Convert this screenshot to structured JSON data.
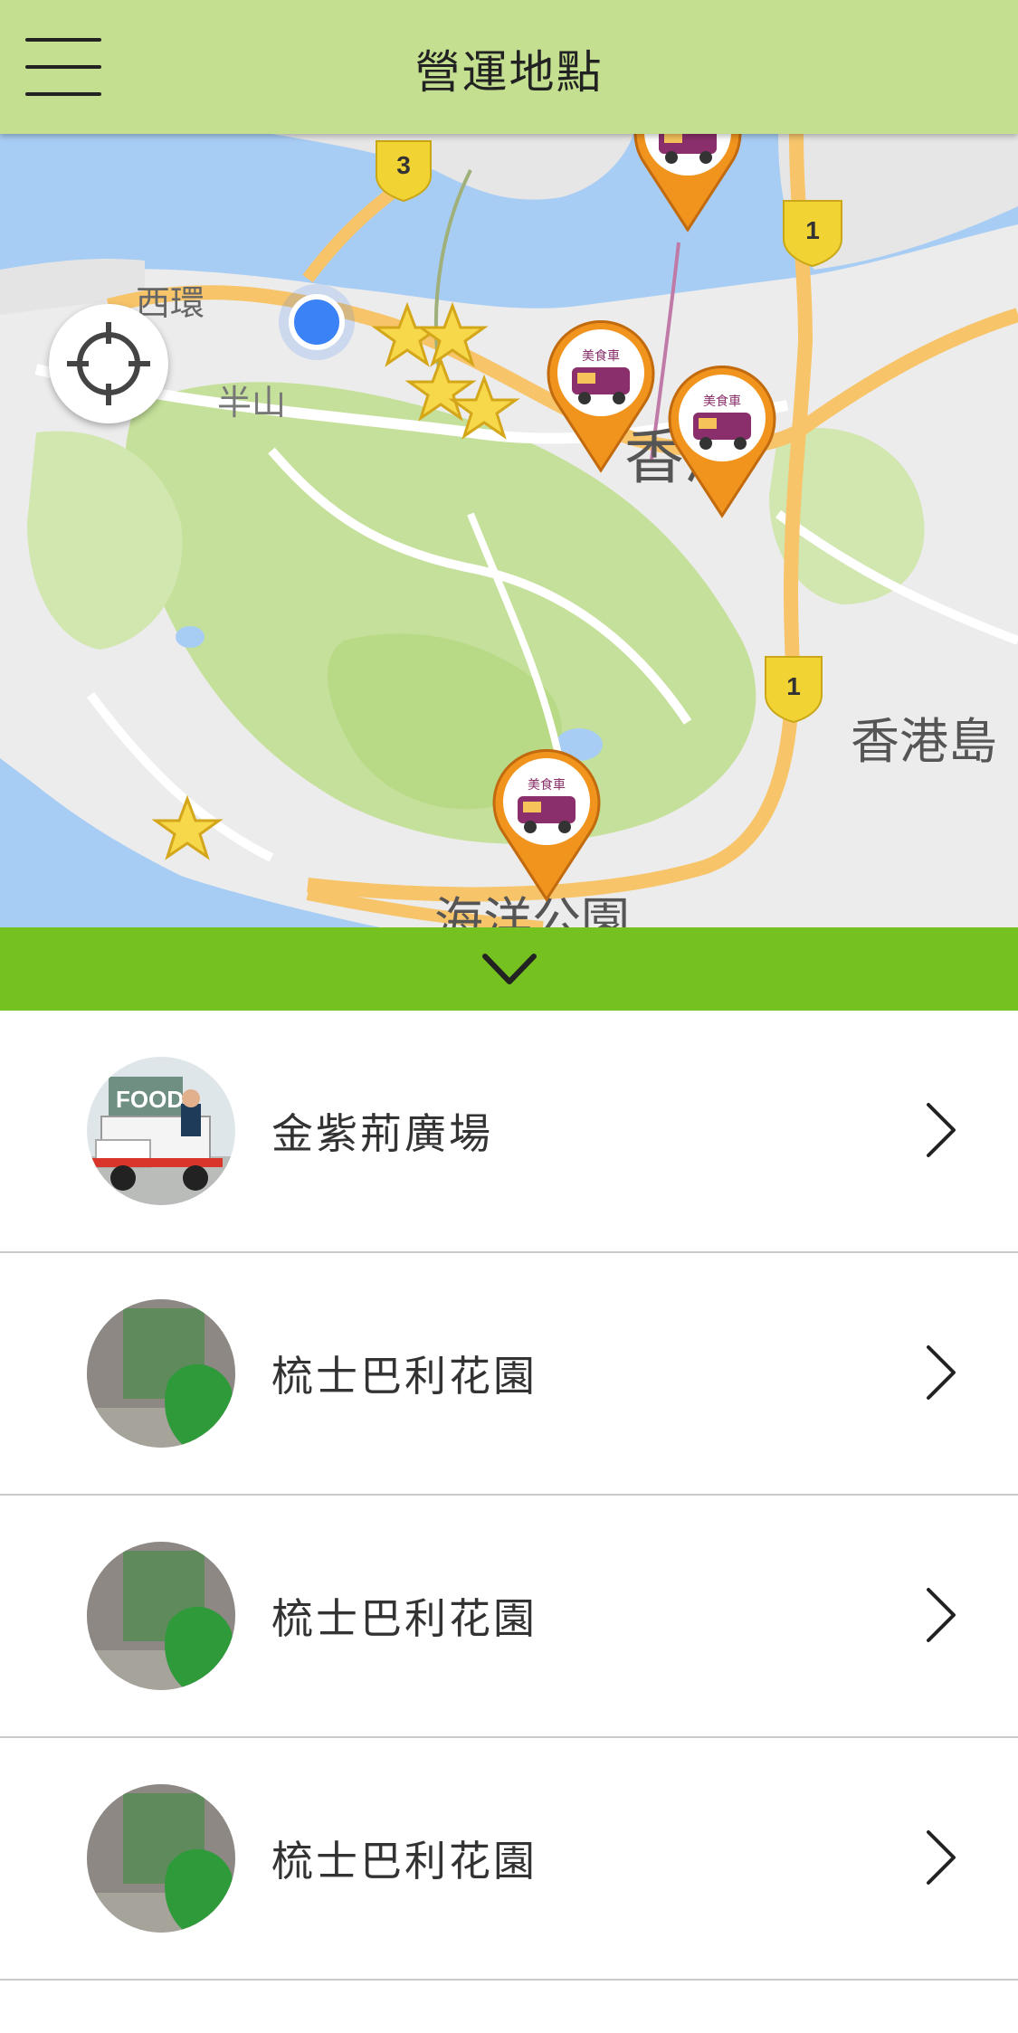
{
  "header": {
    "title": "營運地點",
    "menu_icon": "hamburger-menu-icon"
  },
  "map": {
    "locate_icon": "crosshair-icon",
    "labels": {
      "sai_wan": "西環",
      "mid_levels": "半山",
      "central": "香港",
      "hk_island": "香港島",
      "ocean_park": "海洋公園"
    },
    "route_shields": [
      "3",
      "1",
      "1"
    ],
    "pin_caption": "美食車",
    "colors": {
      "water": "#a8cdf4",
      "land": "#ececec",
      "park": "#c5e09a",
      "road": "#f7c46a",
      "pin": "#f0941e",
      "star": "#f7d84a",
      "user_dot": "#3b82f6"
    }
  },
  "collapse_bar": {
    "icon": "chevron-down-icon",
    "color": "#74c120"
  },
  "list": {
    "items": [
      {
        "label": "金紫荊廣場",
        "thumb": "food-truck-photo",
        "chevron": "chevron-right-icon"
      },
      {
        "label": "梳士巴利花園",
        "thumb": "building-garden-photo",
        "chevron": "chevron-right-icon"
      },
      {
        "label": "梳士巴利花園",
        "thumb": "building-garden-photo",
        "chevron": "chevron-right-icon"
      },
      {
        "label": "梳士巴利花園",
        "thumb": "building-garden-photo",
        "chevron": "chevron-right-icon"
      }
    ]
  }
}
